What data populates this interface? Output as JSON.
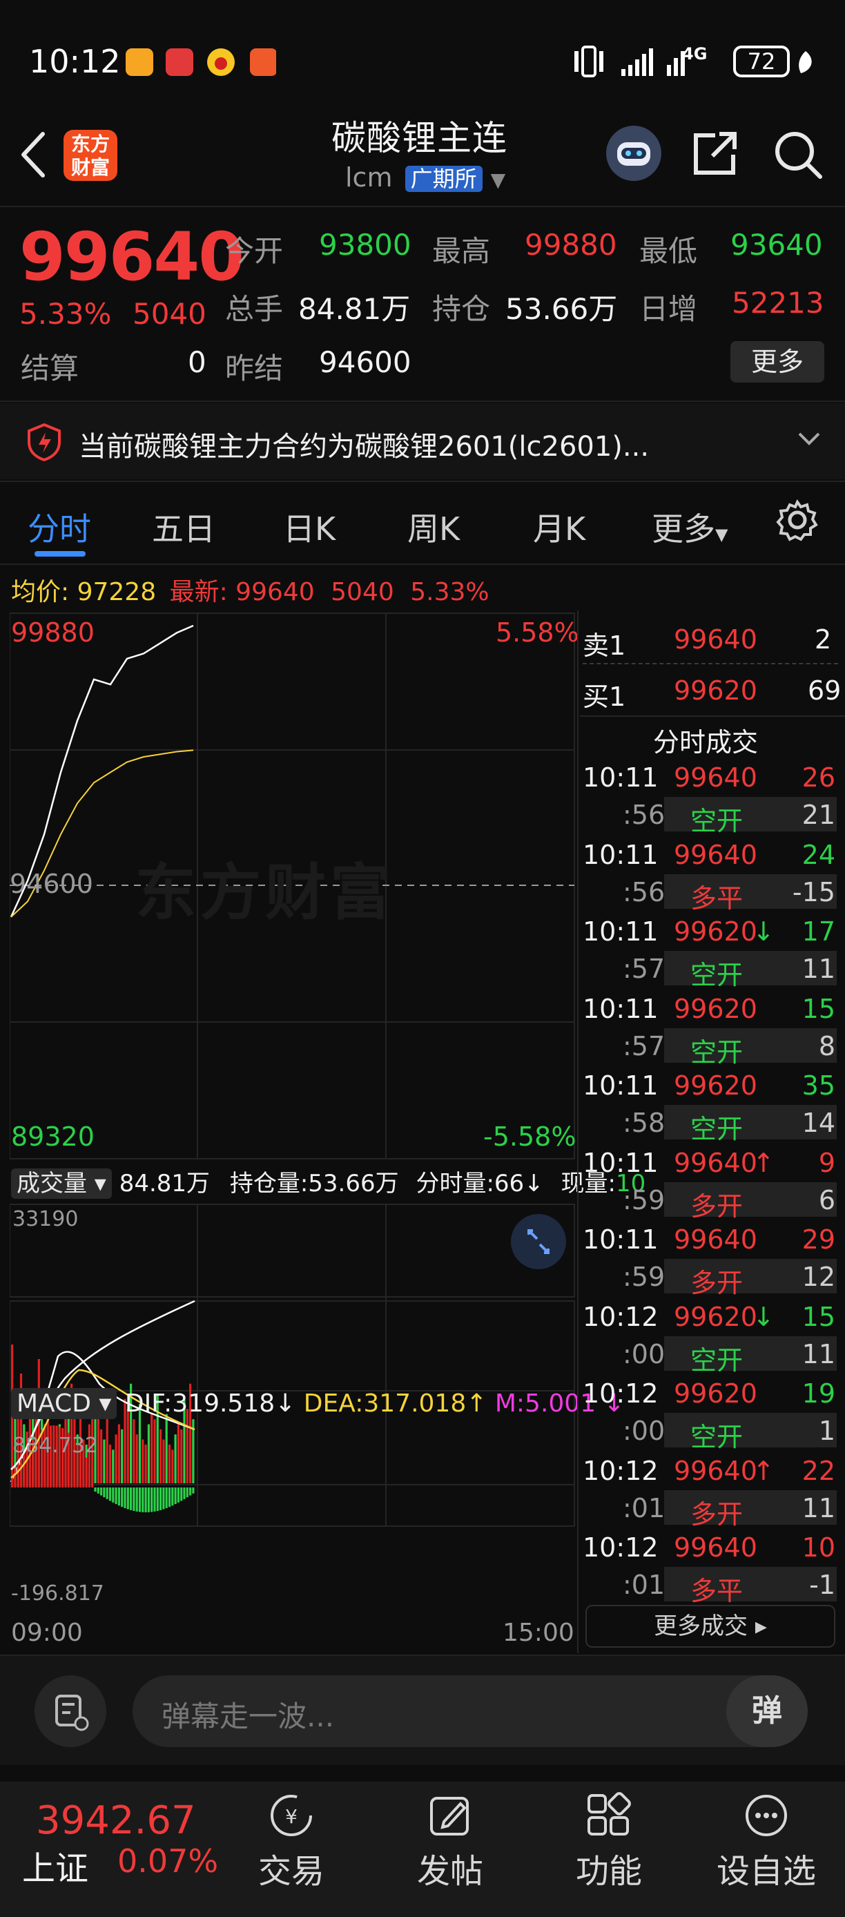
{
  "status_bar": {
    "time": "10:12",
    "battery": "72",
    "network": "4G"
  },
  "header": {
    "back": "‹",
    "logo": "东方财富",
    "title": "碳酸锂主连",
    "code": "lcm",
    "exchange": "广期所"
  },
  "quote": {
    "price": "99640",
    "change_pct": "5.33%",
    "change": "5040",
    "open_label": "今开",
    "open": "93800",
    "high_label": "最高",
    "high": "99880",
    "low_label": "最低",
    "low": "93640",
    "volume_label": "总手",
    "volume": "84.81万",
    "oi_label": "持仓",
    "oi": "53.66万",
    "daily_inc_label": "日增",
    "daily_inc": "52213",
    "settle_label": "结算",
    "settle": "0",
    "prev_settle_label": "昨结",
    "prev_settle": "94600",
    "more_button": "更多"
  },
  "notice": {
    "text": "当前碳酸锂主力合约为碳酸锂2601(lc2601)..."
  },
  "tabs": {
    "t1": "分时",
    "t2": "五日",
    "t3": "日K",
    "t4": "周K",
    "t5": "月K",
    "t6": "更多"
  },
  "info_line": {
    "avg_label": "均价:",
    "avg": "97228",
    "latest_label": "最新:",
    "latest": "99640",
    "chg": "5040",
    "pct": "5.33%"
  },
  "chart": {
    "y_max": "99880",
    "y_min": "89320",
    "y_mid": "94600",
    "pct_max": "5.58%",
    "pct_min": "-5.58%",
    "watermark": "东方财富",
    "x_start": "09:00",
    "x_end": "15:00",
    "vol_label": "成交量",
    "vol_total": "84.81万",
    "vol_oi": "持仓量:53.66万",
    "vol_min": "分时量:66↓",
    "vol_now_label": "现量:",
    "vol_now": "10",
    "vol_max": "33190",
    "macd_label": "MACD",
    "dif": "DIF:319.518↓",
    "dea": "DEA:317.018↑",
    "m": "M:5.001 ↓",
    "macd_max": "884.732",
    "macd_min": "-196.817"
  },
  "chart_data": {
    "type": "line",
    "series": [
      {
        "name": "最新",
        "values": [
          94000,
          94700,
          95600,
          96800,
          97800,
          98600,
          98500,
          99000,
          99100,
          99300,
          99500,
          99640
        ]
      },
      {
        "name": "均价",
        "values": [
          94000,
          94300,
          94900,
          95600,
          96200,
          96600,
          96800,
          97000,
          97100,
          97150,
          97200,
          97228
        ]
      }
    ],
    "ylim": [
      89320,
      99880
    ]
  },
  "order_book": {
    "ask_label": "卖1",
    "ask_price": "99640",
    "ask_vol": "2",
    "bid_label": "买1",
    "bid_price": "99620",
    "bid_vol": "69",
    "ticks_title": "分时成交",
    "ticks": [
      {
        "time": "10:11",
        "price": "99640",
        "arrow": "",
        "vol": "26",
        "sec": ":56",
        "type": "空开",
        "qty": "21"
      },
      {
        "time": "10:11",
        "price": "99640",
        "arrow": "",
        "vol": "24",
        "sec": ":56",
        "type": "多平",
        "qty": "-15"
      },
      {
        "time": "10:11",
        "price": "99620",
        "arrow": "↓",
        "vol": "17",
        "sec": ":57",
        "type": "空开",
        "qty": "11"
      },
      {
        "time": "10:11",
        "price": "99620",
        "arrow": "",
        "vol": "15",
        "sec": ":57",
        "type": "空开",
        "qty": "8"
      },
      {
        "time": "10:11",
        "price": "99620",
        "arrow": "",
        "vol": "35",
        "sec": ":58",
        "type": "空开",
        "qty": "14"
      },
      {
        "time": "10:11",
        "price": "99640",
        "arrow": "↑",
        "vol": "9",
        "sec": ":59",
        "type": "多开",
        "qty": "6"
      },
      {
        "time": "10:11",
        "price": "99640",
        "arrow": "",
        "vol": "29",
        "sec": ":59",
        "type": "多开",
        "qty": "12"
      },
      {
        "time": "10:12",
        "price": "99620",
        "arrow": "↓",
        "vol": "15",
        "sec": ":00",
        "type": "空开",
        "qty": "11"
      },
      {
        "time": "10:12",
        "price": "99620",
        "arrow": "",
        "vol": "19",
        "sec": ":00",
        "type": "空开",
        "qty": "1"
      },
      {
        "time": "10:12",
        "price": "99640",
        "arrow": "↑",
        "vol": "22",
        "sec": ":01",
        "type": "多开",
        "qty": "11"
      },
      {
        "time": "10:12",
        "price": "99640",
        "arrow": "",
        "vol": "10",
        "sec": ":01",
        "type": "多平",
        "qty": "-1"
      }
    ],
    "more_button": "更多成交"
  },
  "comment_bar": {
    "placeholder": "弹幕走一波...",
    "danmaku_icon": "弹"
  },
  "bottom_bar": {
    "index_value": "3942.67",
    "index_name": "上证",
    "index_pct": "0.07%",
    "trade": "交易",
    "post": "发帖",
    "func": "功能",
    "watch": "设自选"
  }
}
